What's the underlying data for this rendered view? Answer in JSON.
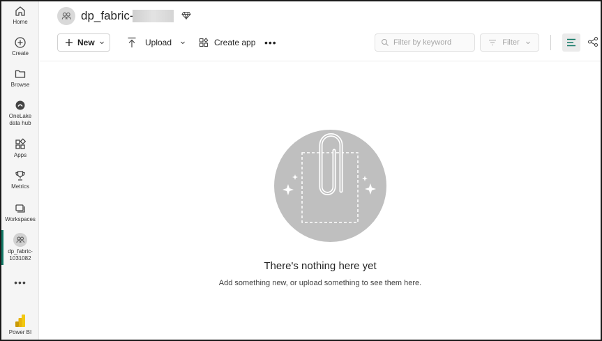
{
  "rail": {
    "items": [
      {
        "label": "Home",
        "icon": "home-icon"
      },
      {
        "label": "Create",
        "icon": "plus-circle-icon"
      },
      {
        "label": "Browse",
        "icon": "folder-icon"
      },
      {
        "label": "OneLake data hub",
        "line1": "OneLake",
        "line2": "data hub",
        "icon": "onelake-icon"
      },
      {
        "label": "Apps",
        "icon": "apps-icon"
      },
      {
        "label": "Metrics",
        "icon": "trophy-icon"
      },
      {
        "label": "Workspaces",
        "icon": "workspaces-icon"
      },
      {
        "label": "dp_fabric-1031082",
        "line1": "dp_fabric-",
        "line2": "1031082",
        "icon": "workspace-avatar-icon"
      }
    ],
    "more": "•••",
    "brand": "Power BI"
  },
  "header": {
    "workspace_title": "dp_fabric-",
    "premium_icon": "diamond-icon"
  },
  "toolbar": {
    "new_label": "New",
    "upload_label": "Upload",
    "create_app_label": "Create app",
    "more_label": "•••",
    "filter_placeholder": "Filter by keyword",
    "filter_label": "Filter"
  },
  "empty_state": {
    "title": "There's nothing here yet",
    "subtitle": "Add something new, or upload something to see them here."
  },
  "colors": {
    "accent": "#117865",
    "powerbi_yellow": "#f2c811"
  }
}
